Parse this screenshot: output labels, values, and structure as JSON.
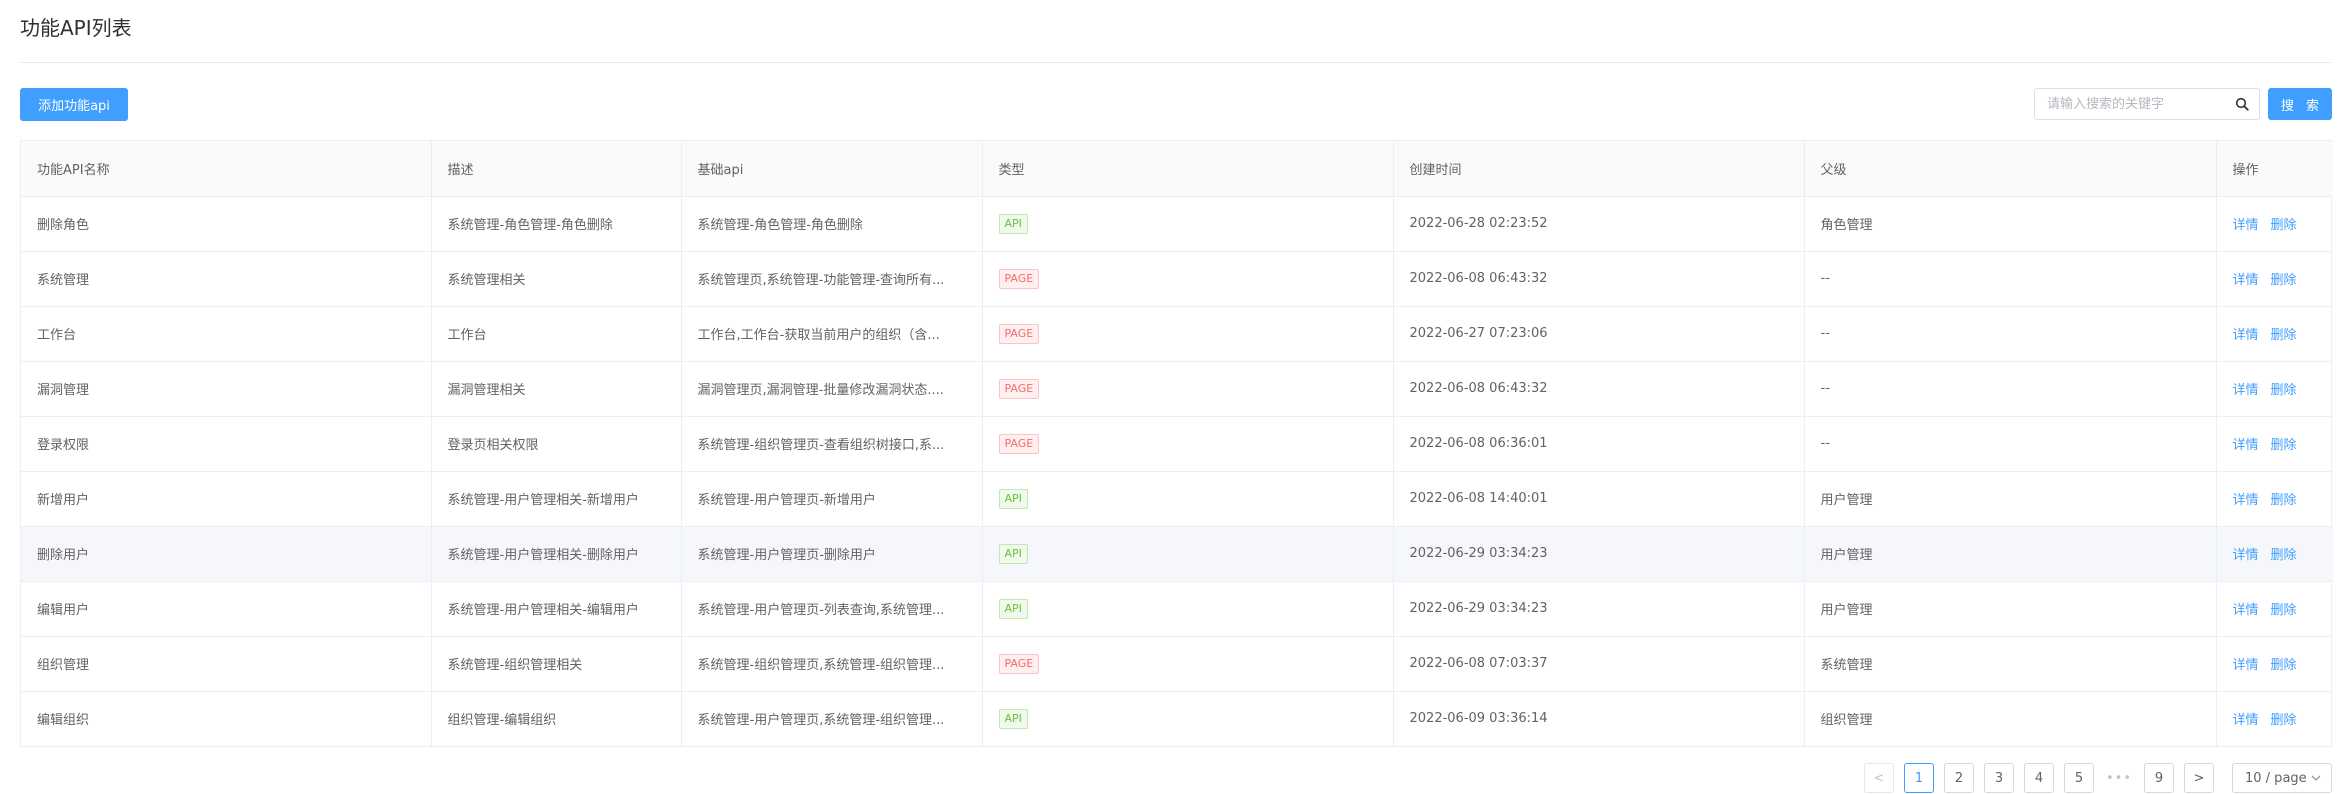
{
  "header": {
    "title": "功能API列表"
  },
  "toolbar": {
    "add_label": "添加功能api",
    "search_placeholder": "请输入搜索的关键字",
    "search_label": "搜 索"
  },
  "table": {
    "columns": [
      "功能API名称",
      "描述",
      "基础api",
      "类型",
      "创建时间",
      "父级",
      "操作"
    ],
    "rows": [
      {
        "name": "删除角色",
        "desc": "系统管理-角色管理-角色删除",
        "base": "系统管理-角色管理-角色删除",
        "type": "API",
        "created": "2022-06-28 02:23:52",
        "parent": "角色管理"
      },
      {
        "name": "系统管理",
        "desc": "系统管理相关",
        "base": "系统管理页,系统管理-功能管理-查询所有...",
        "type": "PAGE",
        "created": "2022-06-08 06:43:32",
        "parent": "--"
      },
      {
        "name": "工作台",
        "desc": "工作台",
        "base": "工作台,工作台-获取当前用户的组织（含...",
        "type": "PAGE",
        "created": "2022-06-27 07:23:06",
        "parent": "--"
      },
      {
        "name": "漏洞管理",
        "desc": "漏洞管理相关",
        "base": "漏洞管理页,漏洞管理-批量修改漏洞状态....",
        "type": "PAGE",
        "created": "2022-06-08 06:43:32",
        "parent": "--"
      },
      {
        "name": "登录权限",
        "desc": "登录页相关权限",
        "base": "系统管理-组织管理页-查看组织树接口,系...",
        "type": "PAGE",
        "created": "2022-06-08 06:36:01",
        "parent": "--"
      },
      {
        "name": "新增用户",
        "desc": "系统管理-用户管理相关-新增用户",
        "base": "系统管理-用户管理页-新增用户",
        "type": "API",
        "created": "2022-06-08 14:40:01",
        "parent": "用户管理"
      },
      {
        "name": "删除用户",
        "desc": "系统管理-用户管理相关-删除用户",
        "base": "系统管理-用户管理页-删除用户",
        "type": "API",
        "created": "2022-06-29 03:34:23",
        "parent": "用户管理"
      },
      {
        "name": "编辑用户",
        "desc": "系统管理-用户管理相关-编辑用户",
        "base": "系统管理-用户管理页-列表查询,系统管理...",
        "type": "API",
        "created": "2022-06-29 03:34:23",
        "parent": "用户管理"
      },
      {
        "name": "组织管理",
        "desc": "系统管理-组织管理相关",
        "base": "系统管理-组织管理页,系统管理-组织管理...",
        "type": "PAGE",
        "created": "2022-06-08 07:03:37",
        "parent": "系统管理"
      },
      {
        "name": "编辑组织",
        "desc": "组织管理-编辑组织",
        "base": "系统管理-用户管理页,系统管理-组织管理...",
        "type": "API",
        "created": "2022-06-09 03:36:14",
        "parent": "组织管理"
      }
    ],
    "actions": {
      "detail": "详情",
      "delete": "删除"
    },
    "highlighted_row": 6
  },
  "pagination": {
    "prev": "<",
    "next": ">",
    "pages": [
      "1",
      "2",
      "3",
      "4",
      "5"
    ],
    "ellipsis": "•••",
    "last_page": "9",
    "current": "1",
    "page_size": "10 / page"
  },
  "colors": {
    "primary": "#409eff",
    "api_tag": "#67c23a",
    "page_tag": "#f56c6c"
  }
}
